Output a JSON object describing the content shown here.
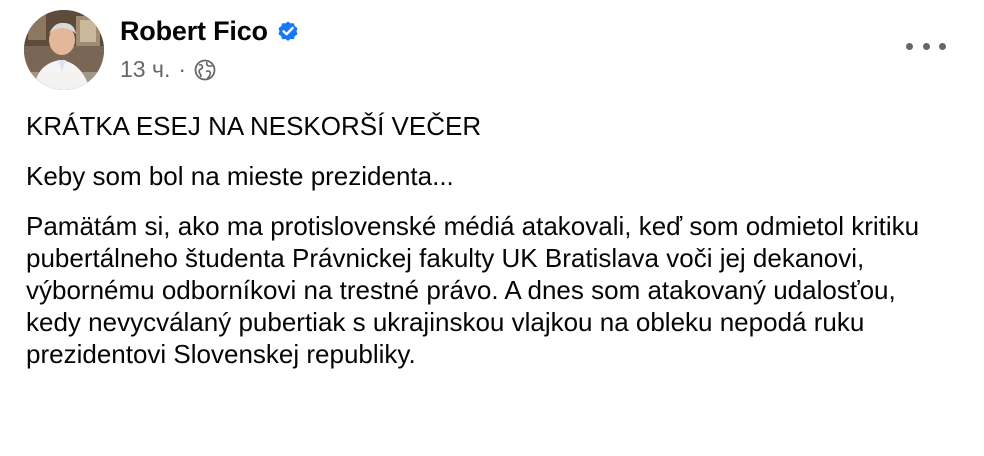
{
  "post": {
    "author": {
      "name": "Robert Fico",
      "verified": true,
      "avatar_icon": "avatar-photo"
    },
    "meta": {
      "timestamp": "13 ч.",
      "separator": "·",
      "audience_icon": "globe-icon"
    },
    "more_icon": "more-options-icon",
    "paragraphs": [
      "KRÁTKA ESEJ NA NESKORŠÍ VEČER",
      "Keby som bol na mieste prezidenta...",
      "Pamätám si, ako ma protislovenské médiá atakovali, keď som odmietol kritiku pubertálneho študenta Právnickej fakulty UK Bratislava voči jej dekanovi, výbornému odborníkovi na trestné právo. A dnes som atakovaný udalosťou, kedy nevycválaný pubertiak s ukrajinskou vlajkou na obleku nepodá ruku prezidentovi Slovenskej republiky."
    ]
  },
  "colors": {
    "verified_badge": "#1877F2",
    "secondary_text": "#65676B",
    "primary_text": "#050505"
  }
}
